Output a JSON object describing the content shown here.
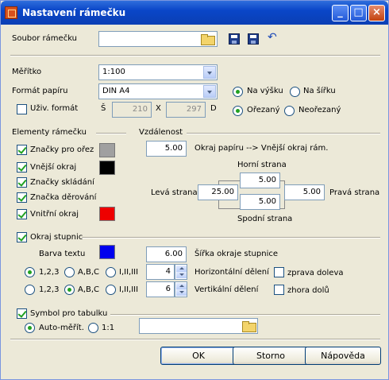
{
  "window": {
    "title": "Nastavení rámečku"
  },
  "frame_file": {
    "label": "Soubor rámečku",
    "value": ""
  },
  "scale": {
    "label": "Měřítko",
    "value": "1:100"
  },
  "paper": {
    "label": "Formát papíru",
    "value": "DIN A4",
    "orient_portrait": "Na výšku",
    "orient_landscape": "Na šířku",
    "cut": "Ořezaný",
    "uncut": "Neořezaný"
  },
  "user_format": {
    "label": "Uživ. formát",
    "w_label": "Š",
    "w_value": "210",
    "x_label": "X",
    "h_value": "297",
    "h_label": "D"
  },
  "elements": {
    "title": "Elementy rámečku",
    "items": [
      {
        "label": "Značky pro ořez",
        "color": "#a0a0a0"
      },
      {
        "label": "Vnější okraj",
        "color": "#000000"
      },
      {
        "label": "Značky skládání"
      },
      {
        "label": "Značka děrování"
      },
      {
        "label": "Vnitřní okraj",
        "color": "#ee0000"
      }
    ]
  },
  "distance": {
    "title": "Vzdálenost",
    "paper_edge": "5.00",
    "paper_edge_label": "Okraj papíru --> Vnější okraj rám.",
    "top_label": "Horní strana",
    "top": "5.00",
    "left_label": "Levá strana",
    "left": "25.00",
    "right_label": "Pravá strana",
    "right": "5.00",
    "bottom_label": "Spodní strana",
    "bottom": "5.00"
  },
  "scale_edge": {
    "title": "Okraj stupnic",
    "text_color_label": "Barva textu",
    "text_color": "#0000ee",
    "width": "6.00",
    "width_label": "Šířka okraje stupnice",
    "h_opt1": "1,2,3",
    "h_opt2": "A,B,C",
    "h_opt3": "I,II,III",
    "h_count": "4",
    "h_label": "Horizontální dělení",
    "h_dir": "zprava doleva",
    "v_opt1": "1,2,3",
    "v_opt2": "A,B,C",
    "v_opt3": "I,II,III",
    "v_count": "6",
    "v_label": "Vertikální dělení",
    "v_dir": "zhora dolů"
  },
  "table_symbol": {
    "title": "Symbol pro tabulku",
    "auto": "Auto-měřít.",
    "ratio": "1:1",
    "value": ""
  },
  "buttons": {
    "ok": "OK",
    "cancel": "Storno",
    "help": "Nápověda"
  }
}
